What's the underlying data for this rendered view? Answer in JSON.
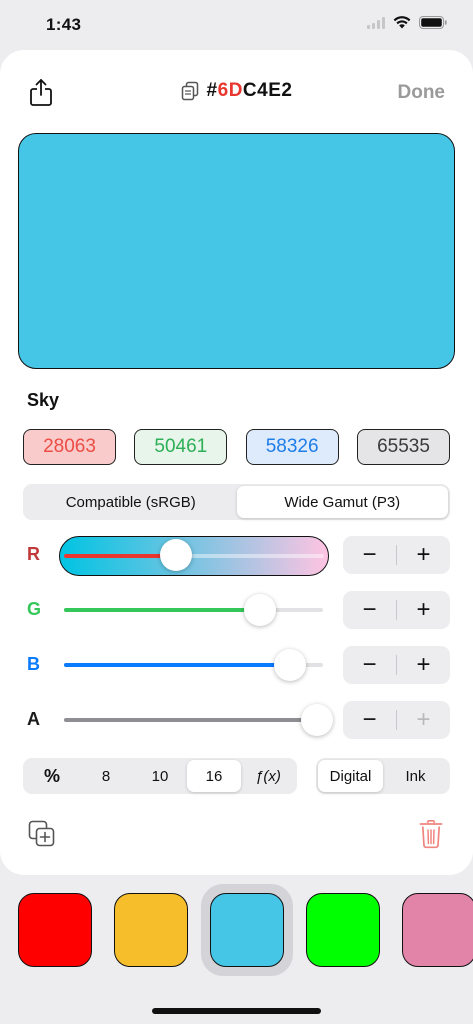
{
  "status": {
    "time": "1:43"
  },
  "header": {
    "hash": "#",
    "hex_red": "6D",
    "hex_rest": "C4E2",
    "done_label": "Done"
  },
  "colors": {
    "current": "#45C6E6",
    "red_accent": "#E9362E",
    "green_accent": "#34C759",
    "blue_accent": "#0A7AFF",
    "gray_accent": "#8E8E93"
  },
  "color_name": "Sky",
  "values": [
    {
      "text": "28063",
      "fg": "#EB4D45",
      "bg": "#F9CBCB"
    },
    {
      "text": "50461",
      "fg": "#2EAF57",
      "bg": "#E7F5EA"
    },
    {
      "text": "58326",
      "fg": "#1F7DE8",
      "bg": "#DDEBFC"
    },
    {
      "text": "65535",
      "fg": "#3A3A3C",
      "bg": "#E5E5E7"
    }
  ],
  "gamut": {
    "options": [
      "Compatible (sRGB)",
      "Wide Gamut (P3)"
    ],
    "selected": 1
  },
  "sliders": [
    {
      "label": "R",
      "label_color": "#C0393A",
      "value": 0.428,
      "fill": "#E9362E"
    },
    {
      "label": "G",
      "label_color": "#34C759",
      "value": 0.77,
      "fill": "#34C759"
    },
    {
      "label": "B",
      "label_color": "#0A7AFF",
      "value": 0.89,
      "fill": "#0A7AFF"
    },
    {
      "label": "A",
      "label_color": "#1C1C1E",
      "value": 1.0,
      "fill": "#8E8E93"
    }
  ],
  "stepper": {
    "minus": "−",
    "plus": "+"
  },
  "radix": {
    "options": [
      "%",
      "8",
      "10",
      "16",
      "ƒ(x)"
    ],
    "selected": 3
  },
  "mode": {
    "options": [
      "Digital",
      "Ink"
    ],
    "selected": 0
  },
  "palette": [
    {
      "color": "#FF0000"
    },
    {
      "color": "#F6BE2B"
    },
    {
      "color": "#45C6E6",
      "selected": true
    },
    {
      "color": "#00FF00"
    },
    {
      "color": "#E184A8"
    }
  ]
}
